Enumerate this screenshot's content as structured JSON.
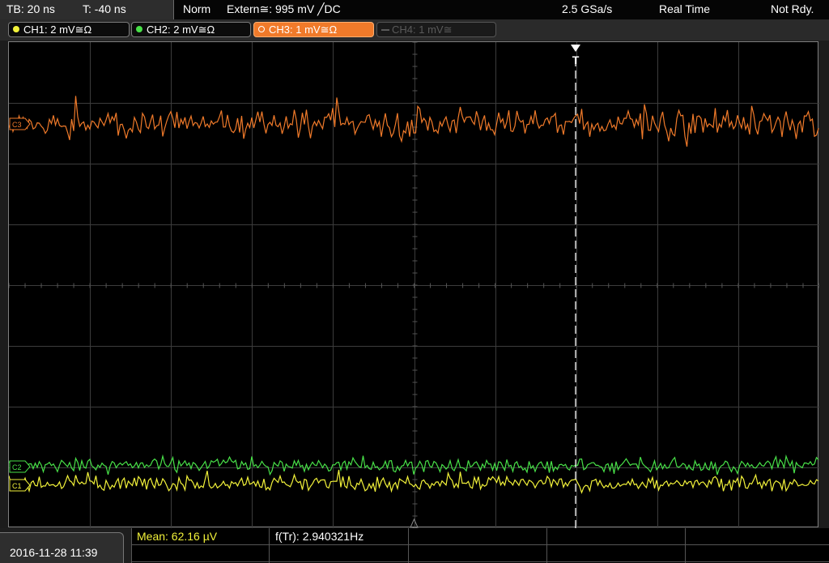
{
  "status_bar": {
    "timebase": "TB: 20 ns",
    "trigger_time": "T: -40 ns",
    "trigger_mode": "Norm",
    "trigger_source": "Extern≅: 995 mV ╱DC",
    "sample_rate": "2.5 GSa/s",
    "acquisition_mode": "Real Time",
    "run_state": "Not Rdy."
  },
  "channels": [
    {
      "label": "CH1: 2 mV≅Ω",
      "color": "#f2f23a",
      "active": true
    },
    {
      "label": "CH2: 2 mV≅Ω",
      "color": "#48e048",
      "active": true
    },
    {
      "label": "CH3: 1 mV≅Ω",
      "color": "#f07a2a",
      "active": true,
      "selected": true
    },
    {
      "label": "CH4: 1 mV≅",
      "color": "#5a5a5a",
      "active": false
    }
  ],
  "display": {
    "trigger_marker": "T",
    "channel_markers": [
      "C3",
      "C2",
      "C1"
    ],
    "grid_divisions": {
      "x": 10,
      "y": 8
    }
  },
  "measurements": {
    "mean": "Mean: 62.16 µV",
    "trigger_frequency": "f(Tr): 2.940321Hz"
  },
  "datetime": "2016-11-28 11:39",
  "colors": {
    "ch1": "#f2f23a",
    "ch2": "#48e048",
    "ch3": "#f07a2a",
    "mean_text": "#f2f23a",
    "grid": "#3c3c3c"
  }
}
